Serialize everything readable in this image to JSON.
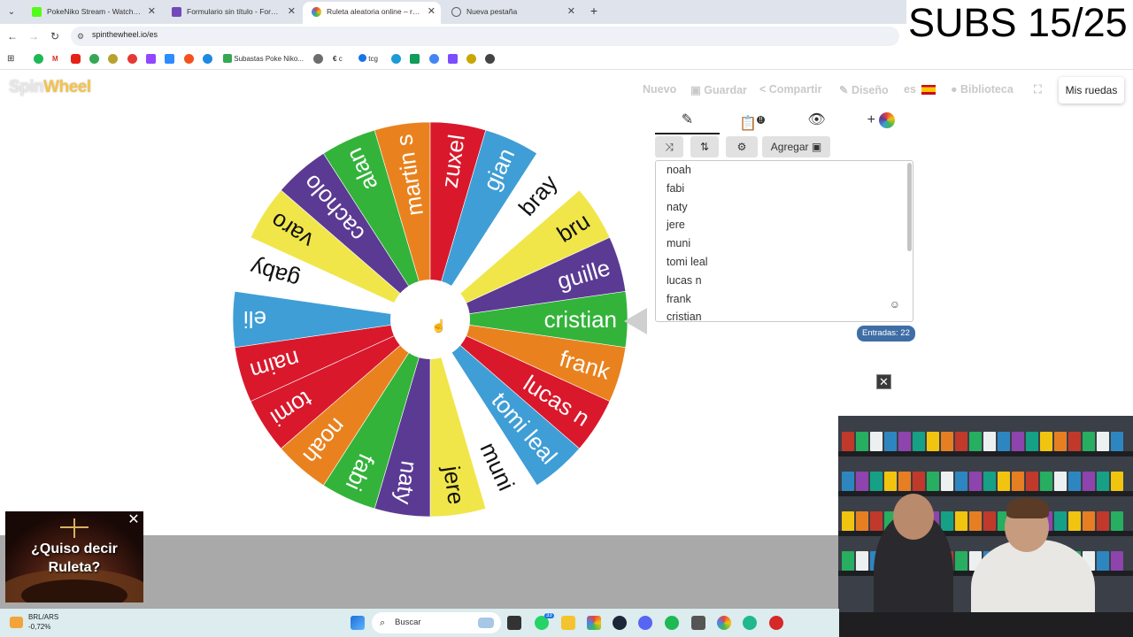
{
  "browser": {
    "tabs": [
      {
        "title": "PokeNiko Stream - Watch Live o",
        "color": "#53fc18"
      },
      {
        "title": "Formulario sin título - Formula",
        "color": "#7248b9"
      },
      {
        "title": "Ruleta aleatoria online – ruleta",
        "color": "#e8453c"
      },
      {
        "title": "Nueva pestaña",
        "color": "#5f6368"
      }
    ],
    "url": "spinthewheel.io/es",
    "bookmarks": {
      "subastas": "Subastas Poke Niko...",
      "c": "c",
      "tcg": "tcg"
    }
  },
  "overlay": {
    "subs": "SUBS 15/25"
  },
  "site": {
    "logo_a": "Spin",
    "logo_b": "Wheel",
    "nav": {
      "nuevo": "Nuevo",
      "guardar": "Guardar",
      "compartir": "Compartir",
      "diseno": "Diseño",
      "lang": "es",
      "biblioteca": "Biblioteca",
      "mis_ruedas": "Mis ruedas"
    },
    "editor": {
      "tabs": {
        "edit": "✎",
        "results_badge": "!!",
        "hide": "👁",
        "add": "+"
      },
      "agregar": "Agregar",
      "entries": [
        "noah",
        "fabi",
        "naty",
        "jere",
        "muni",
        "tomi leal",
        "lucas n",
        "frank",
        "cristian"
      ],
      "count_label": "Entradas: 22"
    }
  },
  "wheel": {
    "slices": [
      {
        "label": "cristian",
        "color": "#33b33a"
      },
      {
        "label": "frank",
        "color": "#e9821e"
      },
      {
        "label": "lucas n",
        "color": "#d9182c"
      },
      {
        "label": "tomi leal",
        "color": "#3f9ed6"
      },
      {
        "label": "muni",
        "color": "#ffffff"
      },
      {
        "label": "jere",
        "color": "#f0e64a"
      },
      {
        "label": "naty",
        "color": "#5b3a93"
      },
      {
        "label": "fabi",
        "color": "#33b33a"
      },
      {
        "label": "noah",
        "color": "#e9821e"
      },
      {
        "label": "tomi",
        "color": "#d9182c"
      },
      {
        "label": "naim",
        "color": "#d9182c"
      },
      {
        "label": "eli",
        "color": "#3f9ed6"
      },
      {
        "label": "gaby",
        "color": "#ffffff"
      },
      {
        "label": "varo",
        "color": "#f0e64a"
      },
      {
        "label": "cacholo",
        "color": "#5b3a93"
      },
      {
        "label": "alan",
        "color": "#33b33a"
      },
      {
        "label": "martin s",
        "color": "#e9821e"
      },
      {
        "label": "zuxel",
        "color": "#d9182c"
      },
      {
        "label": "gian",
        "color": "#3f9ed6"
      },
      {
        "label": "bray",
        "color": "#ffffff"
      },
      {
        "label": "bru",
        "color": "#f0e64a"
      },
      {
        "label": "guille",
        "color": "#5b3a93"
      }
    ]
  },
  "ad": {
    "line1": "¿Quiso decir",
    "line2": "Ruleta?"
  },
  "taskbar": {
    "currency_pair": "BRL/ARS",
    "currency_change": "-0,72%",
    "search": "Buscar",
    "whatsapp_badge": "33"
  }
}
